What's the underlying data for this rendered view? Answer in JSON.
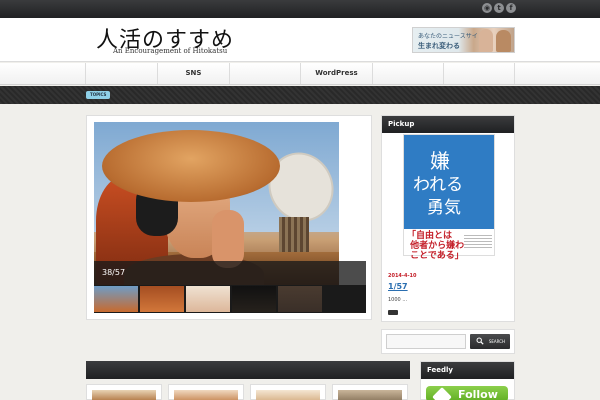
{
  "social": {
    "icons": [
      "rss-icon",
      "twitter-icon",
      "facebook-icon"
    ],
    "glyphs": [
      "◉",
      "t",
      "f"
    ]
  },
  "header": {
    "logo_title": "人活のすすめ",
    "logo_subtitle": "An Encouragement of Hitokatsu",
    "banner": {
      "line1": "あなたのニュースサイトが",
      "line2": "生まれ変わる"
    }
  },
  "nav": {
    "items": [
      "",
      "SNS",
      "",
      "WordPress",
      "",
      ""
    ]
  },
  "topics": {
    "badge": "TOPICS"
  },
  "slider": {
    "counter": "38/57",
    "thumb_colors": [
      "#c86a2e",
      "#d2773a",
      "#ddb79a",
      "#26211c",
      "#3a2f28"
    ]
  },
  "pickup": {
    "heading": "Pickup",
    "book": {
      "title_1": "嫌",
      "title_2": "われる",
      "title_3": "勇気",
      "quote": "「自由とは\n 他者から嫌われる\n ことである」"
    },
    "date": "2014-4-10",
    "title": "1/57",
    "excerpt": "1000 ..."
  },
  "search": {
    "button_label": "SEARCH",
    "placeholder": ""
  },
  "feedly": {
    "heading": "Feedly",
    "follow_label": "Follow"
  },
  "cards": {
    "colors": [
      "#b37a46",
      "#c98c5a",
      "#d8b48a",
      "#8e7a60"
    ]
  },
  "colors": {
    "accent_blue": "#2a6eb0",
    "accent_red": "#c4202a",
    "follow_green": "#6dbb2e",
    "topics_badge": "#8fd0e8"
  }
}
